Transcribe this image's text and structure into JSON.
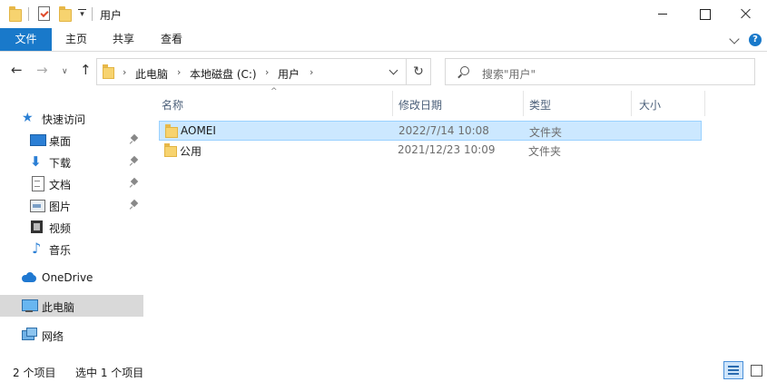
{
  "window": {
    "title": "用户"
  },
  "ribbon": {
    "tabs": [
      "文件",
      "主页",
      "共享",
      "查看"
    ]
  },
  "address": {
    "crumbs": [
      "此电脑",
      "本地磁盘 (C:)",
      "用户"
    ]
  },
  "search": {
    "placeholder": "搜索\"用户\""
  },
  "sidebar": {
    "items": [
      {
        "label": "快速访问",
        "icon": "star-icon",
        "pinned": false
      },
      {
        "label": "桌面",
        "icon": "desktop-icon",
        "pinned": true
      },
      {
        "label": "下载",
        "icon": "download-icon",
        "pinned": true
      },
      {
        "label": "文档",
        "icon": "document-icon",
        "pinned": true
      },
      {
        "label": "图片",
        "icon": "picture-icon",
        "pinned": true
      },
      {
        "label": "视频",
        "icon": "video-icon",
        "pinned": false
      },
      {
        "label": "音乐",
        "icon": "music-icon",
        "pinned": false
      },
      {
        "label": "OneDrive",
        "icon": "cloud-icon",
        "pinned": false
      },
      {
        "label": "此电脑",
        "icon": "computer-icon",
        "pinned": false,
        "selected": true
      },
      {
        "label": "网络",
        "icon": "network-icon",
        "pinned": false
      }
    ]
  },
  "list": {
    "columns": [
      "名称",
      "修改日期",
      "类型",
      "大小"
    ],
    "rows": [
      {
        "name": "AOMEI",
        "date": "2022/7/14 10:08",
        "type": "文件夹",
        "selected": true
      },
      {
        "name": "公用",
        "date": "2021/12/23 10:09",
        "type": "文件夹",
        "selected": false
      }
    ]
  },
  "status": {
    "count": "2 个项目",
    "selection": "选中 1 个项目"
  },
  "colors": {
    "accent": "#1979ca",
    "selection_bg": "#cce8ff",
    "selection_border": "#99d1ff",
    "folder": "#f7d36f"
  }
}
